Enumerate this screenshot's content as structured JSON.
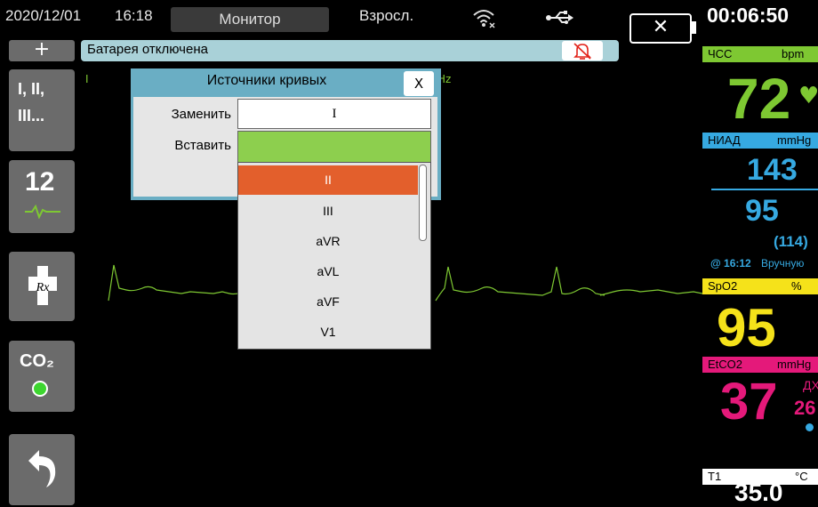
{
  "status_bar": {
    "date": "2020/12/01",
    "time": "16:18",
    "mode_tab": "Монитор",
    "patient_type": "Взросл.",
    "elapsed": "00:06:50"
  },
  "alarm": {
    "add_button": "+",
    "message": "Батарея отключена"
  },
  "left_buttons": {
    "leads": "I, II,\nIII...",
    "leads_line1": "I, II,",
    "leads_line2": "III...",
    "twelve_lead": "12",
    "co2": "CO₂"
  },
  "waveform": {
    "lead_label": "I",
    "filter_label": "Hz"
  },
  "dialog": {
    "title": "Источники кривых",
    "close": "X",
    "replace_label": "Заменить",
    "replace_value": "I",
    "insert_label": "Вставить",
    "options": [
      "II",
      "III",
      "aVR",
      "aVL",
      "aVF",
      "V1"
    ],
    "selected": "II"
  },
  "vitals": {
    "hr": {
      "label": "ЧСС",
      "unit": "bpm",
      "value": "72"
    },
    "nibp": {
      "label": "НИАД",
      "unit": "mmHg",
      "systolic": "143",
      "diastolic": "95",
      "mean": "(114)",
      "time": "@ 16:12",
      "mode": "Вручную"
    },
    "spo2": {
      "label": "SpO2",
      "unit": "%",
      "value": "95"
    },
    "etco2": {
      "label": "EtCO2",
      "unit": "mmHg",
      "value": "37",
      "rr_label": "ДХ",
      "rr_value": "26"
    },
    "t1": {
      "label": "T1",
      "unit": "°C",
      "value": "35.0"
    }
  },
  "colors": {
    "hr": "#7ec832",
    "nibp": "#36a9e1",
    "spo2": "#f5e21a",
    "etco2": "#e4197a",
    "temp": "#ffffff",
    "selected_option": "#e35f2c",
    "dialog_frame": "#6aaec4",
    "alarm_bar": "#a9d1d8"
  }
}
